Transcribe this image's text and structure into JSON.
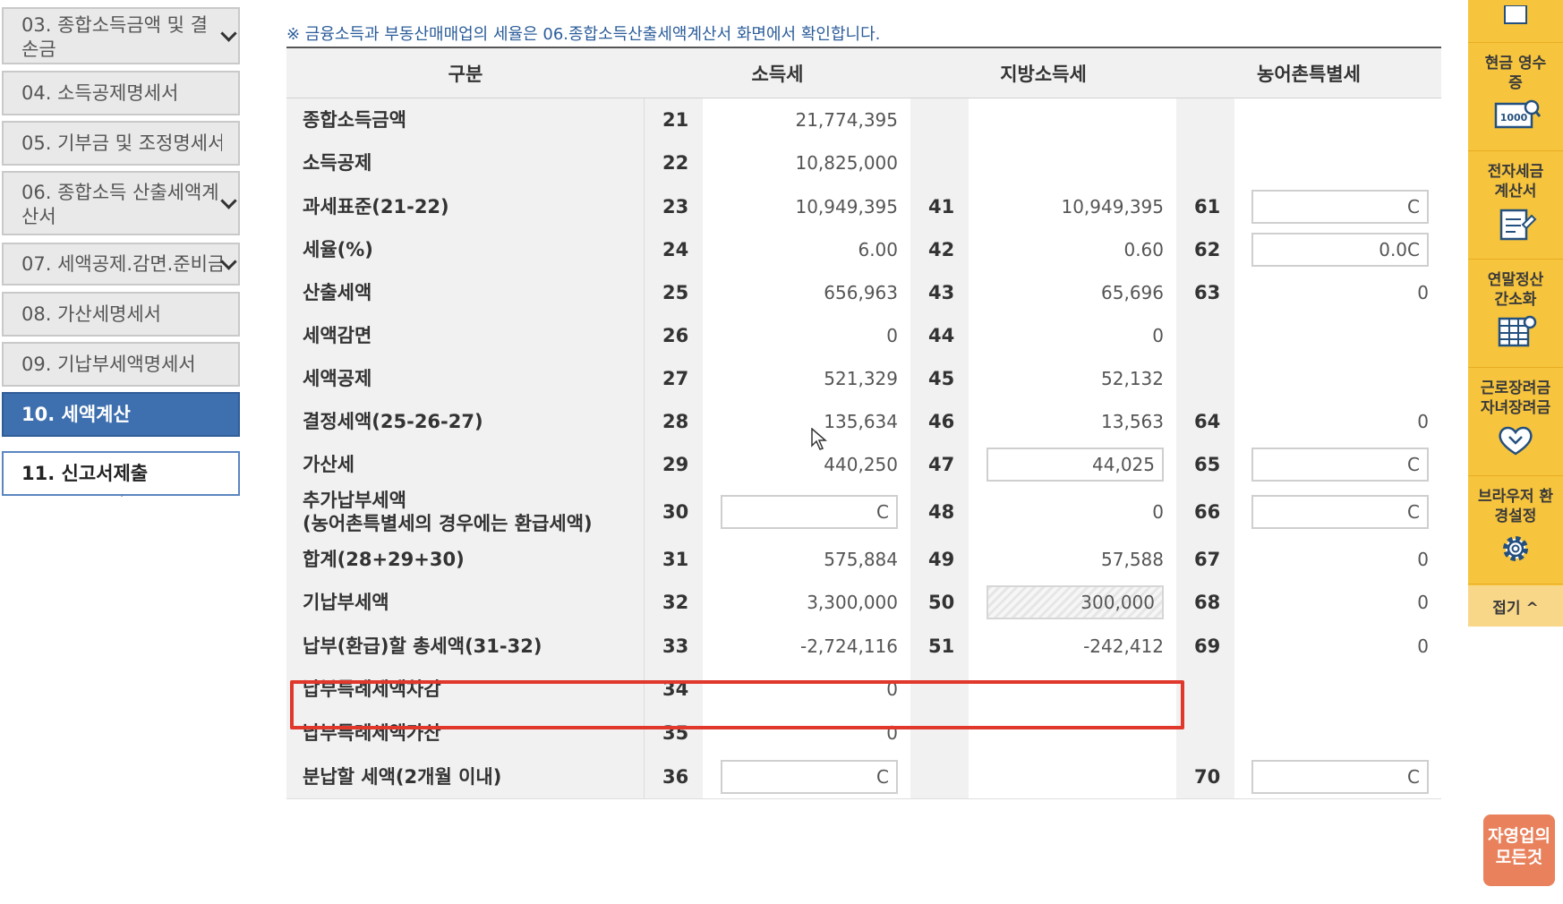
{
  "nav": {
    "items": [
      {
        "label": "03. 종합소득금액 및 결손금",
        "has_dropdown": true
      },
      {
        "label": "04. 소득공제명세서"
      },
      {
        "label": "05. 기부금 및 조정명세서"
      },
      {
        "label": "06. 종합소득 산출세액계산서",
        "has_dropdown": true
      },
      {
        "label": "07. 세액공제.감면.준비금",
        "has_dropdown": true
      },
      {
        "label": "08. 가산세명세서"
      },
      {
        "label": "09. 기납부세액명세서"
      },
      {
        "label": "10. 세액계산",
        "state": "active"
      },
      {
        "label": "11. 신고서제출",
        "state": "next"
      }
    ]
  },
  "notice": "※ 금융소득과 부동산매매업의 세율은 06.종합소득산출세액계산서 화면에서 확인합니다.",
  "table": {
    "headers": [
      "구분",
      "소득세",
      "지방소득세",
      "농어촌특별세"
    ],
    "rows": [
      {
        "label": "종합소득금액",
        "c1": "21",
        "v1": "21,774,395"
      },
      {
        "label": "소득공제",
        "c1": "22",
        "v1": "10,825,000"
      },
      {
        "label": "과세표준(21-22)",
        "c1": "23",
        "v1": "10,949,395",
        "c2": "41",
        "v2": "10,949,395",
        "c3": "61",
        "v3": "C"
      },
      {
        "label": "세율(%)",
        "c1": "24",
        "v1": "6.00",
        "c2": "42",
        "v2": "0.60",
        "c3": "62",
        "v3": "0.0C"
      },
      {
        "label": "산출세액",
        "c1": "25",
        "v1": "656,963",
        "c2": "43",
        "v2": "65,696",
        "c3": "63",
        "v3": "0"
      },
      {
        "label": "세액감면",
        "c1": "26",
        "v1": "0",
        "c2": "44",
        "v2": "0"
      },
      {
        "label": "세액공제",
        "c1": "27",
        "v1": "521,329",
        "c2": "45",
        "v2": "52,132"
      },
      {
        "label": "결정세액(25-26-27)",
        "c1": "28",
        "v1": "135,634",
        "c2": "46",
        "v2": "13,563",
        "c3": "64",
        "v3": "0"
      },
      {
        "label": "가산세",
        "c1": "29",
        "v1": "440,250",
        "c2": "47",
        "v2": "44,025",
        "c3": "65",
        "v3": "C"
      },
      {
        "label": "추가납부세액",
        "label2": "(농어촌특별세의 경우에는 환급세액)",
        "c1": "30",
        "v1": "C",
        "c2": "48",
        "v2": "0",
        "c3": "66",
        "v3": "C"
      },
      {
        "label": "합계(28+29+30)",
        "c1": "31",
        "v1": "575,884",
        "c2": "49",
        "v2": "57,588",
        "c3": "67",
        "v3": "0"
      },
      {
        "label": "기납부세액",
        "c1": "32",
        "v1": "3,300,000",
        "c2": "50",
        "v2": "300,000",
        "c3": "68",
        "v3": "0"
      },
      {
        "label": "납부(환급)할 총세액(31-32)",
        "c1": "33",
        "v1": "-2,724,116",
        "c2": "51",
        "v2": "-242,412",
        "c3": "69",
        "v3": "0"
      },
      {
        "label": "납부특례세액차감",
        "c1": "34",
        "v1": "0"
      },
      {
        "label": "납부특례세액가산",
        "c1": "35",
        "v1": "0"
      },
      {
        "label": "분납할 세액(2개월 이내)",
        "c1": "36",
        "v1": "C",
        "c3": "70",
        "v3": "C"
      }
    ]
  },
  "sidebar": {
    "items": [
      {
        "label": "현금 영수증",
        "icon": "receipt-1000-icon"
      },
      {
        "label": "전자세금 계산서",
        "icon": "invoice-icon"
      },
      {
        "label": "연말정산 간소화",
        "icon": "spreadsheet-icon"
      },
      {
        "label": "근로장려금 자녀장려금",
        "icon": "heart-hands-icon"
      },
      {
        "label": "브라우저 환경설정",
        "icon": "gear-icon"
      }
    ],
    "fold_label": "접기 ^"
  },
  "logo": {
    "line1": "자영업의",
    "line2": "모든것"
  },
  "colors": {
    "accent_nav": "#3e6fae",
    "sidebar": "#f6c43d",
    "highlight": "#e0382b"
  }
}
